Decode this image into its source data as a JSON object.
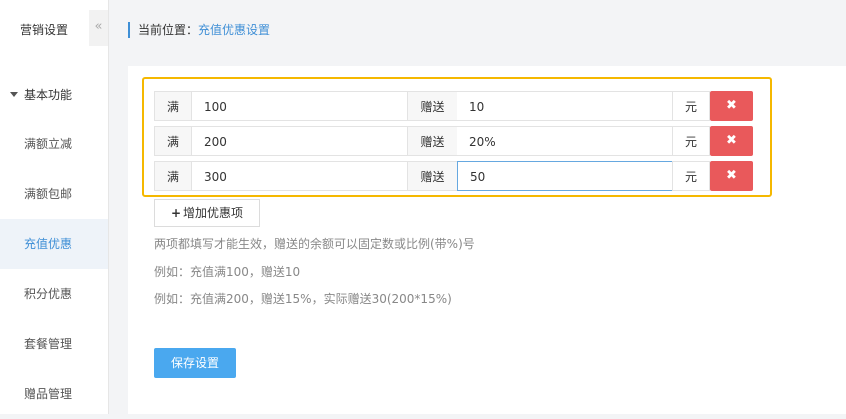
{
  "sidebar": {
    "title": "营销设置",
    "collapse_icon": "«",
    "group_label": "基本功能",
    "items": [
      {
        "label": "满额立减"
      },
      {
        "label": "满额包邮"
      },
      {
        "label": "充值优惠"
      },
      {
        "label": "积分优惠"
      },
      {
        "label": "套餐管理"
      },
      {
        "label": "赠品管理"
      }
    ],
    "active_item": "充值优惠"
  },
  "breadcrumb": {
    "prefix": "当前位置：",
    "current": "充值优惠设置"
  },
  "rules": [
    {
      "full_label": "满",
      "threshold": "100",
      "gift_label": "赠送",
      "gift": "10",
      "unit": "元",
      "delete_icon": "✖"
    },
    {
      "full_label": "满",
      "threshold": "200",
      "gift_label": "赠送",
      "gift": "20%",
      "unit": "元",
      "delete_icon": "✖"
    },
    {
      "full_label": "满",
      "threshold": "300",
      "gift_label": "赠送",
      "gift": "50",
      "unit": "元",
      "delete_icon": "✖"
    }
  ],
  "add_button": {
    "icon": "+",
    "label": "增加优惠项"
  },
  "help": [
    "两项都填写才能生效，赠送的余额可以固定数或比例(带%)号",
    "例如：充值满100，赠送10",
    "例如：充值满200，赠送15%，实际赠送30(200*15%)"
  ],
  "save_button": "保存设置",
  "colors": {
    "accent": "#3f8fd6",
    "delete": "#e9595b",
    "save": "#4aa8ef",
    "highlight": "#f5b800"
  }
}
